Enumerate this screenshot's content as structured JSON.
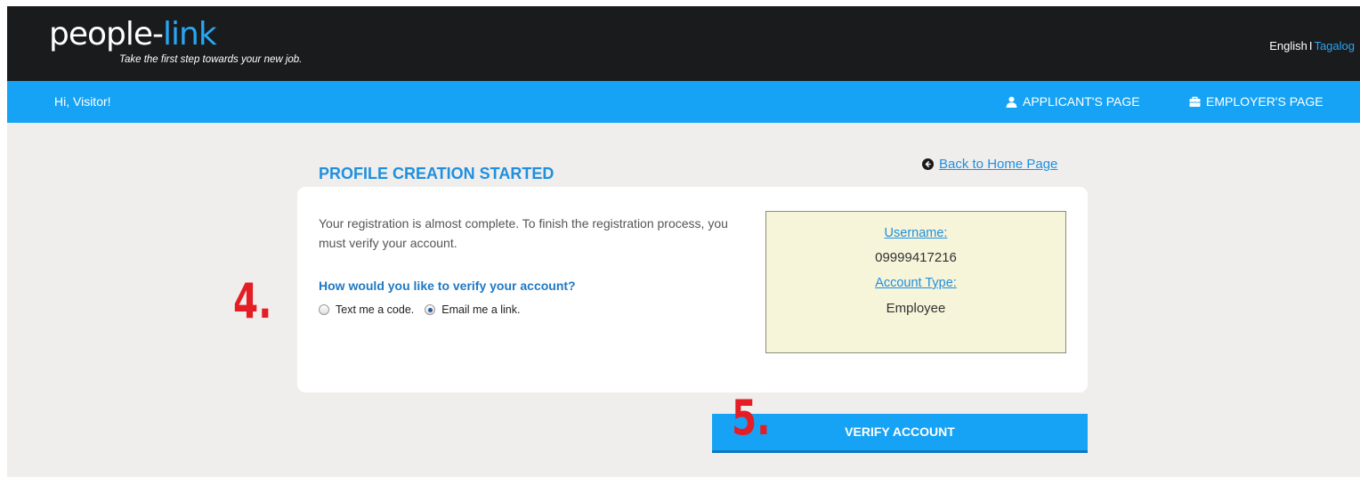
{
  "header": {
    "logo_part1": "people-",
    "logo_part2": "link",
    "tagline": "Take the first step towards your new job.",
    "lang_english": "English",
    "lang_separator": "I",
    "lang_tagalog": "Tagalog"
  },
  "nav": {
    "greeting": "Hi, Visitor!",
    "applicant_label": "APPLICANT'S PAGE",
    "employer_label": "EMPLOYER'S PAGE",
    "applicant_icon": "user-icon",
    "employer_icon": "briefcase-icon"
  },
  "page": {
    "title": "PROFILE CREATION STARTED",
    "back_link": "Back to Home Page",
    "back_icon": "circle-arrow-left-icon"
  },
  "card": {
    "intro": "Your registration is almost complete. To finish the registration process, you must verify your account.",
    "question": "How would you like to verify your account?",
    "options": [
      {
        "label": "Text me a code.",
        "selected": false
      },
      {
        "label": "Email me a link.",
        "selected": true
      }
    ],
    "info": {
      "username_label": "Username:",
      "username_value": "09999417216",
      "account_type_label": "Account Type:",
      "account_type_value": "Employee"
    }
  },
  "verify_button": "VERIFY ACCOUNT",
  "annotations": {
    "step4": "4.",
    "step5": "5."
  },
  "colors": {
    "accent": "#17a3f5",
    "header_bg": "#1a1b1d",
    "annotation": "#e51d24",
    "info_bg": "#f6f4d9"
  }
}
